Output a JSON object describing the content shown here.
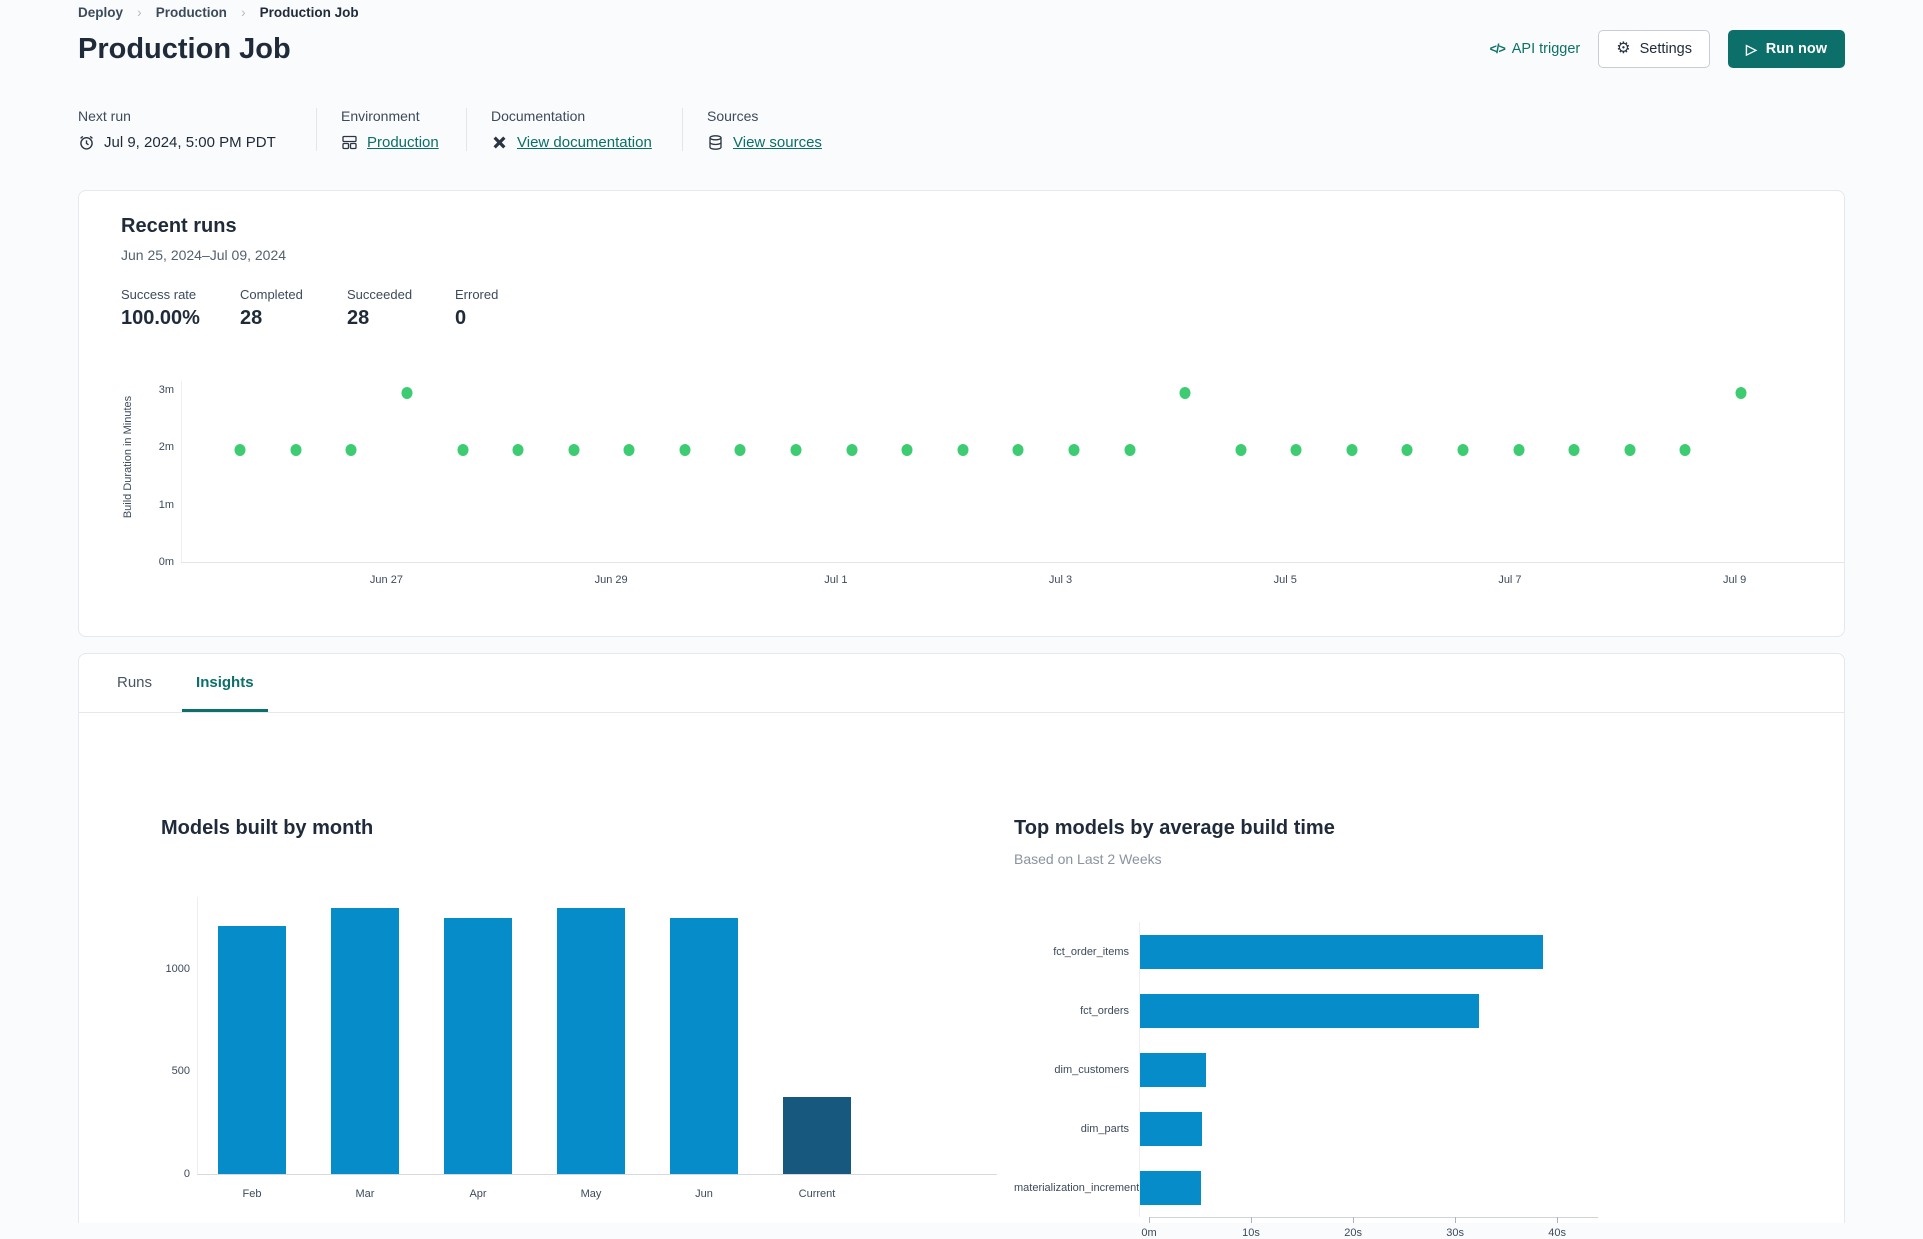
{
  "breadcrumb": {
    "items": [
      "Deploy",
      "Production",
      "Production Job"
    ]
  },
  "header": {
    "title": "Production Job",
    "api_trigger": "API trigger",
    "settings": "Settings",
    "run_now": "Run now"
  },
  "meta": {
    "columns": [
      {
        "label": "Next run",
        "value": "Jul 9, 2024, 5:00 PM PDT"
      },
      {
        "label": "Environment",
        "value": "Production"
      },
      {
        "label": "Documentation",
        "value": "View documentation"
      },
      {
        "label": "Sources",
        "value": "View sources"
      }
    ]
  },
  "recent_runs": {
    "title": "Recent runs",
    "date_range": "Jun 25, 2024–Jul 09, 2024",
    "stats": [
      {
        "label": "Success rate",
        "value": "100.00%"
      },
      {
        "label": "Completed",
        "value": "28"
      },
      {
        "label": "Succeeded",
        "value": "28"
      },
      {
        "label": "Errored",
        "value": "0"
      }
    ]
  },
  "tabs": [
    {
      "label": "Runs",
      "active": false
    },
    {
      "label": "Insights",
      "active": true
    }
  ],
  "colors": {
    "accent_teal": "#0d6f6a",
    "link_teal": "#0b6f68",
    "dot_green": "#3ecc73",
    "bar_blue": "#068cc9",
    "bar_dark_blue": "#17587f"
  },
  "chart_data": [
    {
      "id": "build-duration-scatter",
      "type": "scatter",
      "ylabel": "Build Duration in Minutes",
      "yticks": [
        {
          "label": "0m",
          "value": 0
        },
        {
          "label": "1m",
          "value": 1
        },
        {
          "label": "2m",
          "value": 2
        },
        {
          "label": "3m",
          "value": 3
        }
      ],
      "ylim": [
        0,
        3.15
      ],
      "x_labels": [
        "Jun 27",
        "Jun 29",
        "Jul 1",
        "Jul 3",
        "Jul 5",
        "Jul 7",
        "Jul 9"
      ],
      "point_color": "#3ecc73",
      "points_minutes": [
        1.95,
        1.95,
        1.95,
        2.95,
        1.95,
        1.95,
        1.95,
        1.95,
        1.95,
        1.95,
        1.95,
        1.95,
        1.95,
        1.95,
        1.95,
        1.95,
        1.95,
        2.95,
        1.95,
        1.95,
        1.95,
        1.95,
        1.95,
        1.95,
        1.95,
        1.95,
        1.95,
        2.95
      ]
    },
    {
      "id": "models-built-by-month",
      "type": "bar",
      "title": "Models built by month",
      "categories": [
        "Feb",
        "Mar",
        "Apr",
        "May",
        "Jun",
        "Current"
      ],
      "values": [
        1210,
        1295,
        1250,
        1295,
        1250,
        375
      ],
      "yticks": [
        0,
        500,
        1000
      ],
      "ylim": [
        0,
        1350
      ],
      "bar_color": "#068cc9",
      "highlight_index": 5,
      "highlight_color": "#17587f"
    },
    {
      "id": "top-models-by-avg-build-time",
      "type": "bar-horizontal",
      "title": "Top models by average build time",
      "subtitle": "Based on Last 2 Weeks",
      "categories": [
        "fct_order_items",
        "fct_orders",
        "dim_customers",
        "dim_parts",
        "materialization_incremental"
      ],
      "values_seconds": [
        39.6,
        33.3,
        6.5,
        6.1,
        6.0
      ],
      "xticks": [
        {
          "label": "0m",
          "value": 0
        },
        {
          "label": "10s",
          "value": 10
        },
        {
          "label": "20s",
          "value": 20
        },
        {
          "label": "30s",
          "value": 30
        },
        {
          "label": "40s",
          "value": 40
        }
      ],
      "xlim": [
        0,
        44
      ],
      "bar_color": "#068cc9"
    }
  ]
}
